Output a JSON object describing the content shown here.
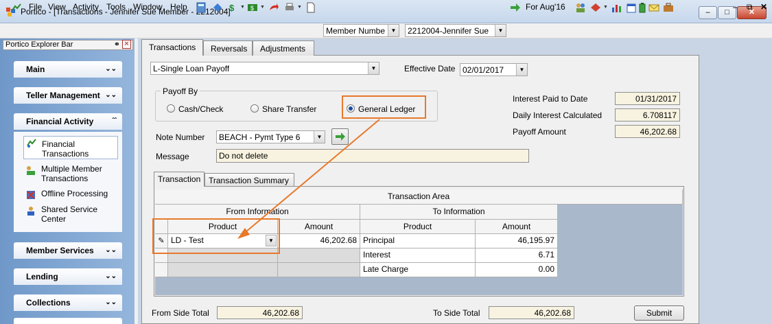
{
  "window": {
    "title": "Portico - [Transactions - Jennifer Sue Member - 2212004]"
  },
  "menu": [
    "File",
    "View",
    "Activity",
    "Tools",
    "Window",
    "Help"
  ],
  "toolbar": {
    "member_search_type": "Member Numbe",
    "member_value": "2212004-Jennifer Sue",
    "period": "For Aug'16"
  },
  "explorer": {
    "title": "Portico Explorer Bar",
    "groups": [
      "Main",
      "Teller Management",
      "Financial Activity",
      "Member Services",
      "Lending",
      "Collections"
    ],
    "financial_items": [
      "Financial Transactions",
      "Multiple Member Transactions",
      "Offline Processing",
      "Shared Service Center"
    ]
  },
  "tabs": [
    "Transactions",
    "Reversals",
    "Adjustments"
  ],
  "form": {
    "transaction_type": "L-Single Loan Payoff",
    "effective_date_label": "Effective Date",
    "effective_date": "02/01/2017",
    "payoff_by_label": "Payoff By",
    "payoff_options": [
      "Cash/Check",
      "Share Transfer",
      "General Ledger"
    ],
    "note_number_label": "Note Number",
    "note_number": "BEACH - Pymt Type 6",
    "message_label": "Message",
    "message": "Do not delete",
    "interest_paid_label": "Interest Paid to Date",
    "interest_paid": "01/31/2017",
    "daily_interest_label": "Daily Interest Calculated",
    "daily_interest": "6.708117",
    "payoff_amount_label": "Payoff Amount",
    "payoff_amount": "46,202.68"
  },
  "subtabs": [
    "Transaction",
    "Transaction Summary"
  ],
  "grid": {
    "title": "Transaction Area",
    "from_header": "From Information",
    "to_header": "To Information",
    "col_product": "Product",
    "col_amount": "Amount",
    "from_product": "LD - Test",
    "from_amount": "46,202.68",
    "to_rows": [
      {
        "product": "Principal",
        "amount": "46,195.97"
      },
      {
        "product": "Interest",
        "amount": "6.71"
      },
      {
        "product": "Late Charge",
        "amount": "0.00"
      }
    ]
  },
  "totals": {
    "from_label": "From Side Total",
    "from_value": "46,202.68",
    "to_label": "To Side Total",
    "to_value": "46,202.68"
  },
  "submit_label": "Submit"
}
